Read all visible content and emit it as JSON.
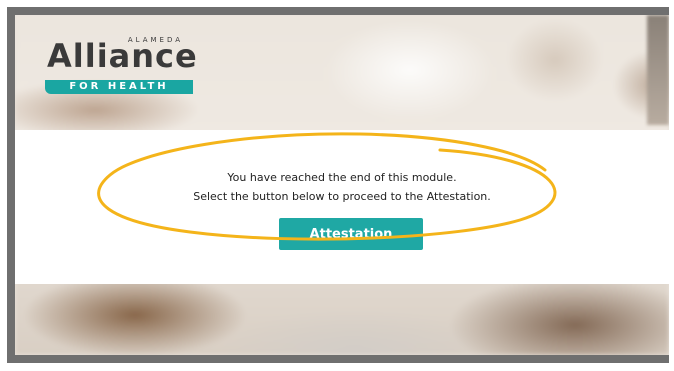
{
  "logo": {
    "word": "Alliance",
    "small_text": "ALAMEDA",
    "bar_text": "FOR HEALTH"
  },
  "message": {
    "line1": "You have reached the end of this module.",
    "line2": "Select the button below to proceed to the Attestation."
  },
  "attestation_button": {
    "label": "Attestation"
  },
  "colors": {
    "brand_teal": "#1aa6a2",
    "annotation_yellow": "#f4b41a",
    "frame_gray": "#6f6f6f"
  }
}
